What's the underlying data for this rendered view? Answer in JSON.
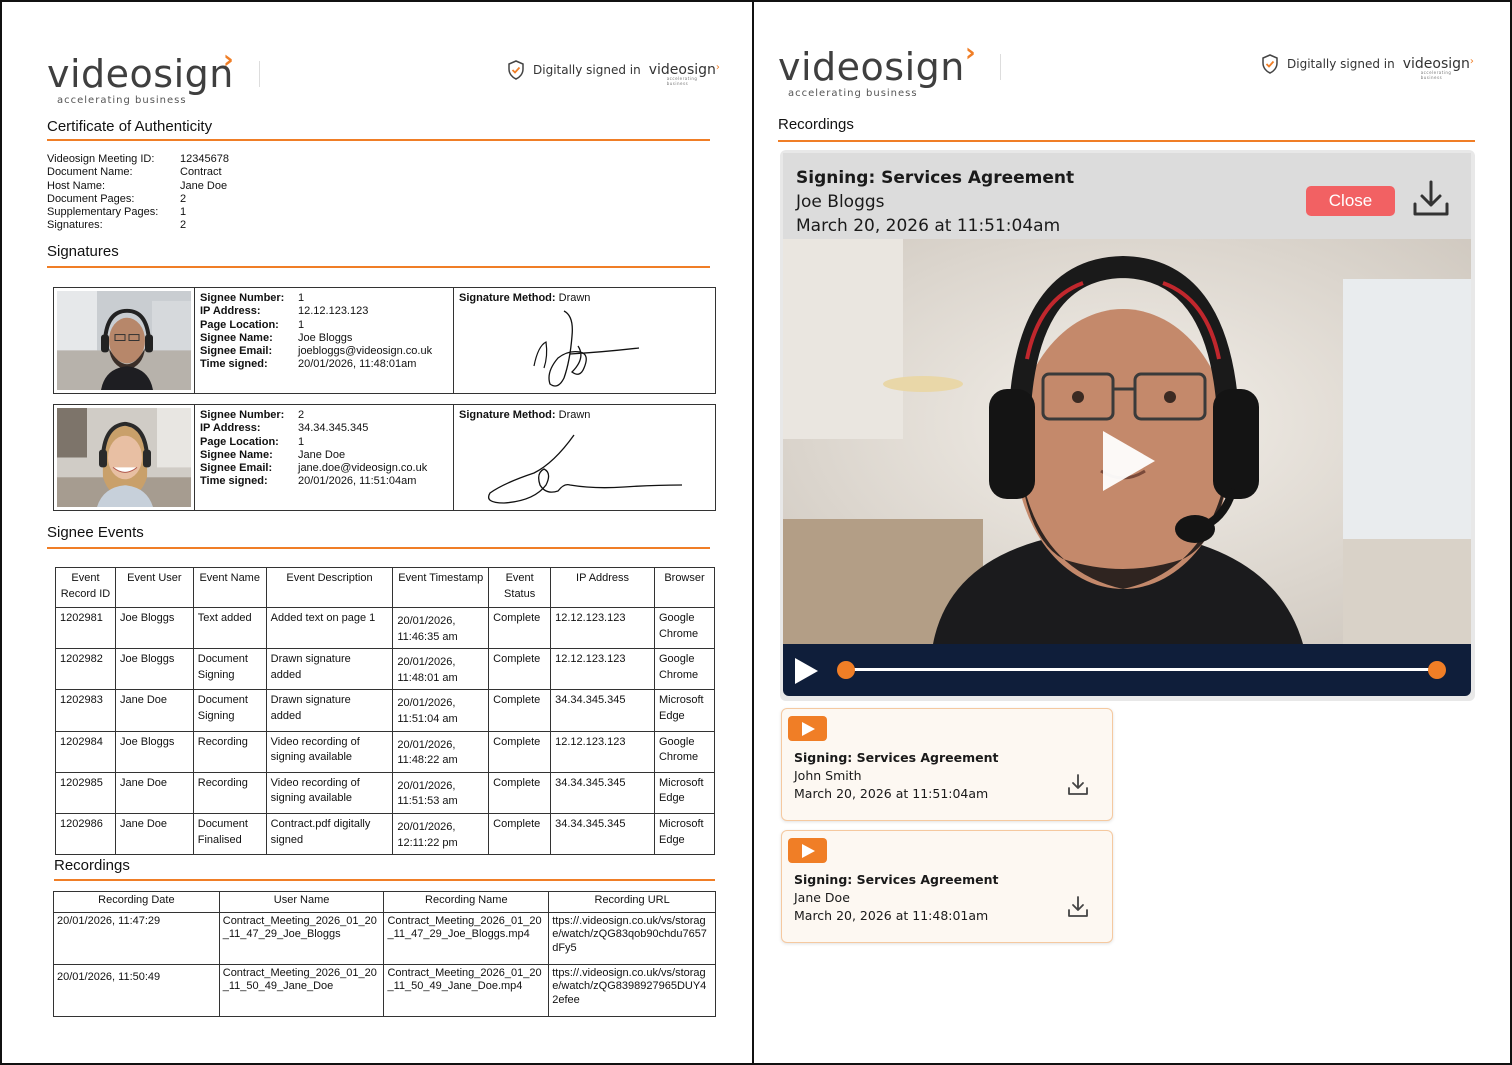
{
  "brand": {
    "name": "videosign",
    "tagline": "accelerating business",
    "digitally_signed": "Digitally signed in",
    "mini_tagline": "accelerating business"
  },
  "certificate": {
    "title": "Certificate of Authenticity",
    "info": [
      {
        "label": "Videosign Meeting ID:",
        "value": "12345678"
      },
      {
        "label": "Document Name:",
        "value": "Contract"
      },
      {
        "label": "Host Name:",
        "value": "Jane Doe"
      },
      {
        "label": "Document Pages:",
        "value": "2"
      },
      {
        "label": "Supplementary Pages:",
        "value": "1"
      },
      {
        "label": "Signatures:",
        "value": "2"
      }
    ],
    "signatures_title": "Signatures",
    "signatures": [
      {
        "fields": [
          {
            "label": "Signee Number:",
            "value": "1"
          },
          {
            "label": "IP Address:",
            "value": "12.12.123.123"
          },
          {
            "label": "Page Location:",
            "value": "1"
          },
          {
            "label": "Signee Name:",
            "value": "Joe Bloggs"
          },
          {
            "label": "Signee Email:",
            "value": "joebloggs@videosign.co.uk"
          },
          {
            "label": "Time signed:",
            "value": "20/01/2026, 11:48:01am"
          }
        ],
        "method_label": "Signature Method:",
        "method_value": "Drawn"
      },
      {
        "fields": [
          {
            "label": "Signee Number:",
            "value": "2"
          },
          {
            "label": "IP Address:",
            "value": "34.34.345.345"
          },
          {
            "label": "Page Location:",
            "value": "1"
          },
          {
            "label": "Signee Name:",
            "value": "Jane Doe"
          },
          {
            "label": "Signee Email:",
            "value": "jane.doe@videosign.co.uk"
          },
          {
            "label": "Time signed:",
            "value": "20/01/2026, 11:51:04am"
          }
        ],
        "method_label": "Signature Method:",
        "method_value": "Drawn"
      }
    ],
    "events_title": "Signee Events",
    "events_headers": [
      [
        "Event",
        "Record ID"
      ],
      [
        "Event User"
      ],
      [
        "Event Name"
      ],
      [
        "Event Description"
      ],
      [
        "Event Timestamp"
      ],
      [
        "Event",
        "Status"
      ],
      [
        "IP Address"
      ],
      [
        "Browser"
      ]
    ],
    "events": [
      {
        "id": "1202981",
        "user": "Joe Bloggs",
        "name": [
          "Text added"
        ],
        "desc": [
          "Added text on page 1"
        ],
        "ts": [
          "20/01/2026,",
          "11:46:35 am"
        ],
        "status": "Complete",
        "ip": "12.12.123.123",
        "browser": [
          "Google",
          "Chrome"
        ]
      },
      {
        "id": "1202982",
        "user": "Joe Bloggs",
        "name": [
          "Document",
          "Signing"
        ],
        "desc": [
          "Drawn signature",
          "added"
        ],
        "ts": [
          "20/01/2026,",
          "11:48:01 am"
        ],
        "status": "Complete",
        "ip": "12.12.123.123",
        "browser": [
          "Google",
          "Chrome"
        ]
      },
      {
        "id": "1202983",
        "user": "Jane Doe",
        "name": [
          "Document",
          "Signing"
        ],
        "desc": [
          "Drawn signature",
          "added"
        ],
        "ts": [
          "20/01/2026,",
          "11:51:04 am"
        ],
        "status": "Complete",
        "ip": "34.34.345.345",
        "browser": [
          "Microsoft",
          "Edge"
        ]
      },
      {
        "id": "1202984",
        "user": "Joe Bloggs",
        "name": [
          "Recording"
        ],
        "desc": [
          "Video recording of",
          "signing available"
        ],
        "ts": [
          "20/01/2026,",
          "11:48:22 am"
        ],
        "status": "Complete",
        "ip": "12.12.123.123",
        "browser": [
          "Google",
          "Chrome"
        ]
      },
      {
        "id": "1202985",
        "user": "Jane Doe",
        "name": [
          "Recording"
        ],
        "desc": [
          "Video recording of",
          "signing available"
        ],
        "ts": [
          "20/01/2026,",
          "11:51:53 am"
        ],
        "status": "Complete",
        "ip": "34.34.345.345",
        "browser": [
          "Microsoft",
          "Edge"
        ]
      },
      {
        "id": "1202986",
        "user": "Jane Doe",
        "name": [
          "Document",
          "Finalised"
        ],
        "desc": [
          "Contract.pdf digitally",
          "signed"
        ],
        "ts": [
          "20/01/2026,",
          "12:11:22 pm"
        ],
        "status": "Complete",
        "ip": "34.34.345.345",
        "browser": [
          "Microsoft",
          "Edge"
        ]
      }
    ],
    "recordings_title": "Recordings",
    "recordings_headers": [
      "Recording Date",
      "User Name",
      "Recording Name",
      "Recording URL"
    ],
    "recordings": [
      {
        "date": "20/01/2026, 11:47:29",
        "user": "Contract_Meeting_2026_01_20_11_47_29_Joe_Bloggs",
        "name": "Contract_Meeting_2026_01_20_11_47_29_Joe_Bloggs.mp4",
        "url": "ttps://.videosign.co.uk/vs/storage/watch/zQG83qob90chdu7657dFy5"
      },
      {
        "date": "20/01/2026, 11:50:49",
        "user": "Contract_Meeting_2026_01_20_11_50_49_Jane_Doe",
        "name": "Contract_Meeting_2026_01_20_11_50_49_Jane_Doe.mp4",
        "url": "ttps://.videosign.co.uk/vs/storage/watch/zQG8398927965DUY42efee"
      }
    ]
  },
  "recordings_panel": {
    "title": "Recordings",
    "player": {
      "title": "Signing: Services Agreement",
      "name": "Joe Bloggs",
      "date": "March 20, 2026 at 11:51:04am",
      "close_label": "Close"
    },
    "cards": [
      {
        "title": "Signing: Services Agreement",
        "name": "John Smith",
        "date": "March 20, 2026 at 11:51:04am"
      },
      {
        "title": "Signing: Services Agreement",
        "name": "Jane Doe",
        "date": "March 20, 2026 at 11:48:01am"
      }
    ]
  },
  "colors": {
    "accent": "#f07e26",
    "close": "#f26163",
    "player_bar": "#0f1e3a"
  }
}
